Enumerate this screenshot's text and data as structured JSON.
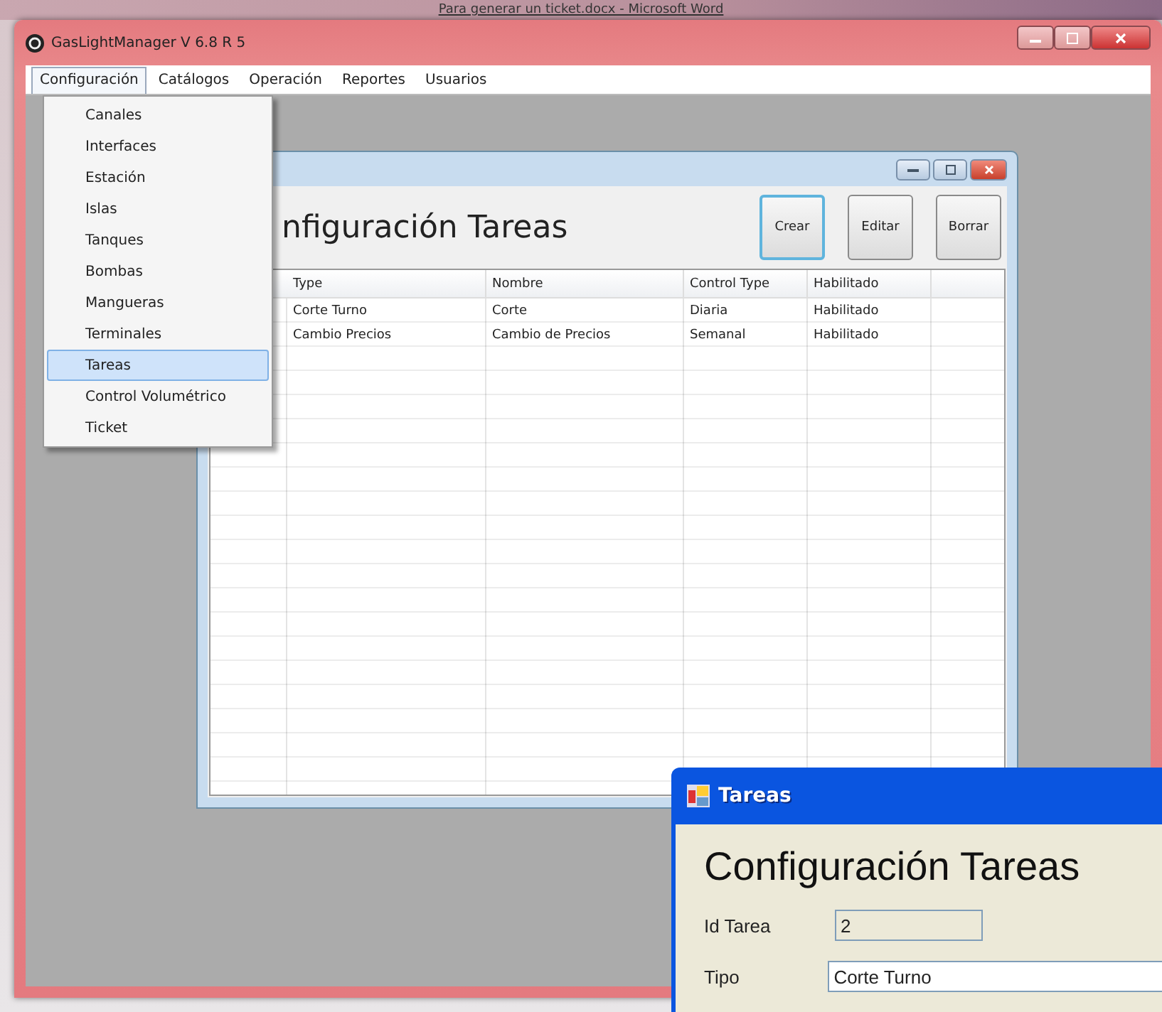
{
  "background_window": {
    "title": "Para generar un ticket.docx - Microsoft Word"
  },
  "main_window": {
    "title": "GasLightManager V 6.8 R 5"
  },
  "menu_bar": [
    {
      "label": "Configuración",
      "selected": true
    },
    {
      "label": "Catálogos",
      "selected": false
    },
    {
      "label": "Operación",
      "selected": false
    },
    {
      "label": "Reportes",
      "selected": false
    },
    {
      "label": "Usuarios",
      "selected": false
    }
  ],
  "dropdown_menu": [
    {
      "label": "Canales",
      "selected": false
    },
    {
      "label": "Interfaces",
      "selected": false
    },
    {
      "label": "Estación",
      "selected": false
    },
    {
      "label": "Islas",
      "selected": false
    },
    {
      "label": "Tanques",
      "selected": false
    },
    {
      "label": "Bombas",
      "selected": false
    },
    {
      "label": "Mangueras",
      "selected": false
    },
    {
      "label": "Terminales",
      "selected": false
    },
    {
      "label": "Tareas",
      "selected": true
    },
    {
      "label": "Control Volumétrico",
      "selected": false
    },
    {
      "label": "Ticket",
      "selected": false
    }
  ],
  "child_window": {
    "heading": "nfiguración Tareas",
    "buttons": [
      {
        "label": "Crear",
        "focused": true
      },
      {
        "label": "Editar",
        "focused": false
      },
      {
        "label": "Borrar",
        "focused": false
      }
    ],
    "table": {
      "columns": [
        "Type",
        "Nombre",
        "Control Type",
        "Habilitado"
      ],
      "rows": [
        [
          "Corte Turno",
          "Corte",
          "Diaria",
          "Habilitado"
        ],
        [
          "Cambio Precios",
          "Cambio de Precios",
          "Semanal",
          "Habilitado"
        ]
      ]
    }
  },
  "form_window": {
    "title": "Tareas",
    "heading": "Configuración Tareas",
    "fields": [
      {
        "label": "Id Tarea",
        "value": "2",
        "disabled": true
      },
      {
        "label": "Tipo",
        "value": "Corte Turno",
        "disabled": false
      }
    ]
  }
}
